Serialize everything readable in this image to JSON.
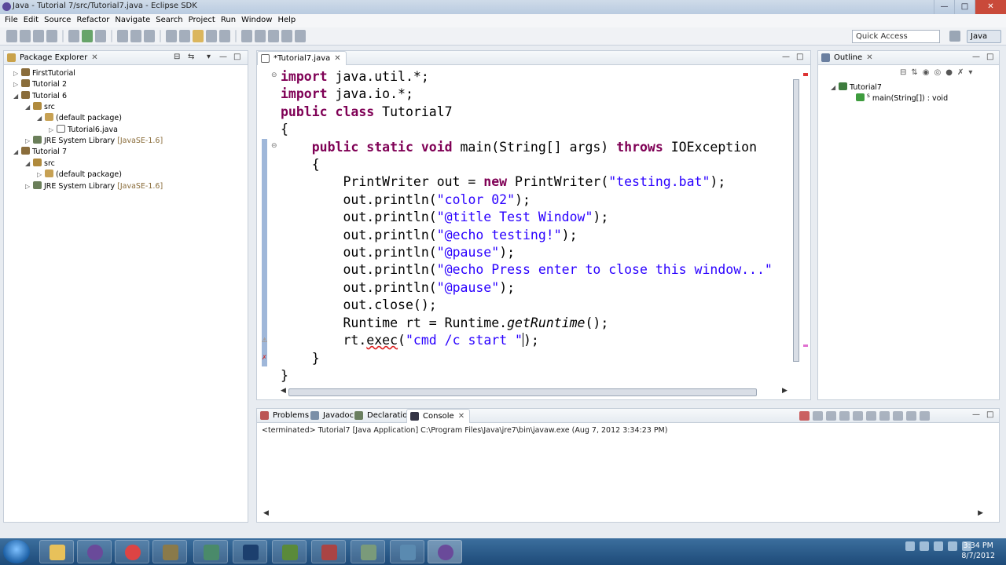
{
  "window": {
    "title": "Java - Tutorial 7/src/Tutorial7.java - Eclipse SDK"
  },
  "menu": [
    "File",
    "Edit",
    "Source",
    "Refactor",
    "Navigate",
    "Search",
    "Project",
    "Run",
    "Window",
    "Help"
  ],
  "toolbar": {
    "quick_access": "Quick Access",
    "perspective": "Java"
  },
  "package_explorer": {
    "tab": "Package Explorer",
    "items": [
      {
        "label": "FirstTutorial"
      },
      {
        "label": "Tutorial 2"
      },
      {
        "label": "Tutorial 6"
      },
      {
        "label": "src"
      },
      {
        "label": "(default package)"
      },
      {
        "label": "Tutorial6.java"
      },
      {
        "label": "JRE System Library",
        "detail": "[JavaSE-1.6]"
      },
      {
        "label": "Tutorial 7"
      },
      {
        "label": "src"
      },
      {
        "label": "(default package)"
      },
      {
        "label": "JRE System Library",
        "detail": "[JavaSE-1.6]"
      }
    ]
  },
  "editor": {
    "tab": "*Tutorial7.java",
    "lines": {
      "l1_kw": "import",
      "l1_rest": " java.util.*;",
      "l2_kw": "import",
      "l2_rest": " java.io.*;",
      "l3_kw": "public class",
      "l3_rest": " Tutorial7",
      "l4": "{",
      "l5_kw": "public static void",
      "l5_rest": " main(String[] args) ",
      "l5_kw2": "throws",
      "l5_rest2": " IOException",
      "l6": "{",
      "l7_a": "PrintWriter out = ",
      "l7_kw": "new",
      "l7_b": " PrintWriter(",
      "l7_str": "\"testing.bat\"",
      "l7_c": ");",
      "l8_a": "out.println(",
      "l8_str": "\"color 02\"",
      "l8_b": ");",
      "l9_a": "out.println(",
      "l9_str": "\"@title Test Window\"",
      "l9_b": ");",
      "l10_a": "out.println(",
      "l10_str": "\"@echo testing!\"",
      "l10_b": ");",
      "l11_a": "out.println(",
      "l11_str": "\"@pause\"",
      "l11_b": ");",
      "l12_a": "out.println(",
      "l12_str": "\"@echo Press enter to close this window...\"",
      "l13_a": "out.println(",
      "l13_str": "\"@pause\"",
      "l13_b": ");",
      "l14": "out.close();",
      "l15_a": "Runtime rt = Runtime.",
      "l15_it": "getRuntime",
      "l15_b": "();",
      "l16_a": "rt.",
      "l16_sq": "exec",
      "l16_b": "(",
      "l16_str": "\"cmd /c start \"",
      "l16_c": ");",
      "l17": "}",
      "l18": "}"
    }
  },
  "outline": {
    "tab": "Outline",
    "class_name": "Tutorial7",
    "method": "main(String[]) : void",
    "method_marker": "S"
  },
  "console": {
    "tabs": [
      "Problems",
      "Javadoc",
      "Declaration",
      "Console"
    ],
    "status": "<terminated> Tutorial7 [Java Application] C:\\Program Files\\Java\\jre7\\bin\\javaw.exe (Aug 7, 2012 3:34:23 PM)"
  },
  "taskbar": {
    "time": "3:34 PM",
    "date": "8/7/2012"
  },
  "colors": {
    "keyword": "#7f0055",
    "string": "#2a00ff",
    "taskbar": "#2a5a8a"
  }
}
